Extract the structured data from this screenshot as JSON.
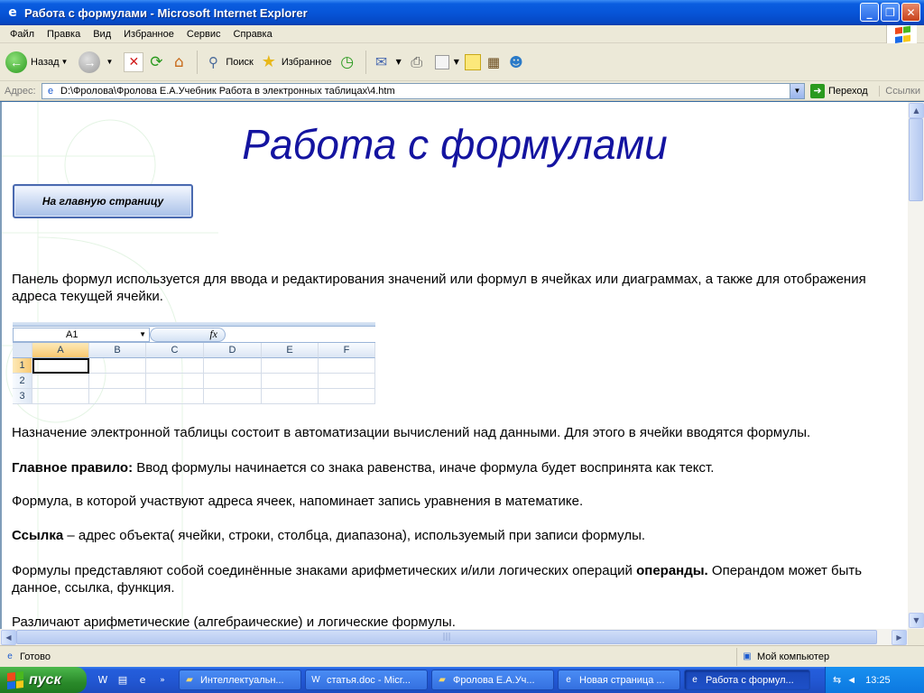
{
  "window": {
    "title": "Работа с формулами - Microsoft Internet Explorer",
    "ie_icon": "ie-icon"
  },
  "menu": [
    "Файл",
    "Правка",
    "Вид",
    "Избранное",
    "Сервис",
    "Справка"
  ],
  "toolbar": {
    "back_label": "Назад",
    "search_label": "Поиск",
    "favorites_label": "Избранное"
  },
  "address": {
    "label": "Адрес:",
    "value": "D:\\Фролова\\Фролова Е.А.Учебник Работа в электронных таблицах\\4.htm",
    "go_label": "Переход",
    "links_label": "Ссылки"
  },
  "page": {
    "title": "Работа с формулами",
    "home_button": "На главную страницу",
    "p1": "Панель формул используется для ввода и редактирования значений или формул в ячейках или диаграммах, а также для отображения адреса текущей ячейки.",
    "p2": "Назначение электронной таблицы состоит в автоматизации вычислений над данными. Для этого в ячейки вводятся формулы.",
    "p3_bold": "Главное правило:",
    "p3_rest": " Ввод формулы начинается со знака равенства, иначе формула будет воспринята как текст.",
    "p4": "Формула, в которой участвуют адреса ячеек, напоминает запись уравнения в математике.",
    "p5_bold": "Ссылка",
    "p5_rest": " – адрес объекта( ячейки, строки, столбца, диапазона), используемый при записи формулы.",
    "p6_a": "Формулы представляют собой соединённые знаками арифметических и/или логических операций ",
    "p6_bold": "операнды.",
    "p6_b": "  Операндом может быть данное, ссылка, функция.",
    "p7": "Различают арифметические (алгебраические) и логические формулы."
  },
  "excel": {
    "namebox": "A1",
    "fx": "fx",
    "columns": [
      "A",
      "B",
      "C",
      "D",
      "E",
      "F"
    ],
    "rows": [
      "1",
      "2",
      "3"
    ]
  },
  "status": {
    "left": "Готово",
    "right": "Мой компьютер"
  },
  "taskbar": {
    "start": "пуск",
    "tasks": [
      "Интеллектуальн...",
      "статья.doc - Micr...",
      "Фролова Е.А.Уч...",
      "Новая страница ...",
      "Работа с формул..."
    ],
    "lang": "RU",
    "clock": "13:25"
  },
  "colors": {
    "title_blue": "#1414a0",
    "xp_blue": "#0a5de0",
    "start_green": "#2a8a2a"
  }
}
